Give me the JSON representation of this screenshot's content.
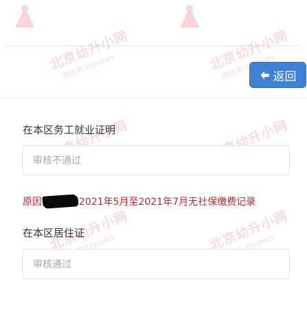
{
  "back_button": {
    "label": "返回",
    "icon": "arrow-left-icon"
  },
  "work_certificate": {
    "label": "在本区务工就业证明",
    "status": "审核不通过"
  },
  "rejection_reason": {
    "prefix": "原因",
    "text": "2021年5月至2021年7月无社保缴费记录",
    "color": "#c4262e"
  },
  "residence_permit": {
    "label": "在本区居住证",
    "status": "审核通过"
  },
  "watermark": {
    "title": "北京幼升小网",
    "subtitle": "微信号:bjysxwx",
    "color": "#d9252a"
  },
  "colors": {
    "accent": "#3d82d6",
    "error": "#c4262e"
  }
}
